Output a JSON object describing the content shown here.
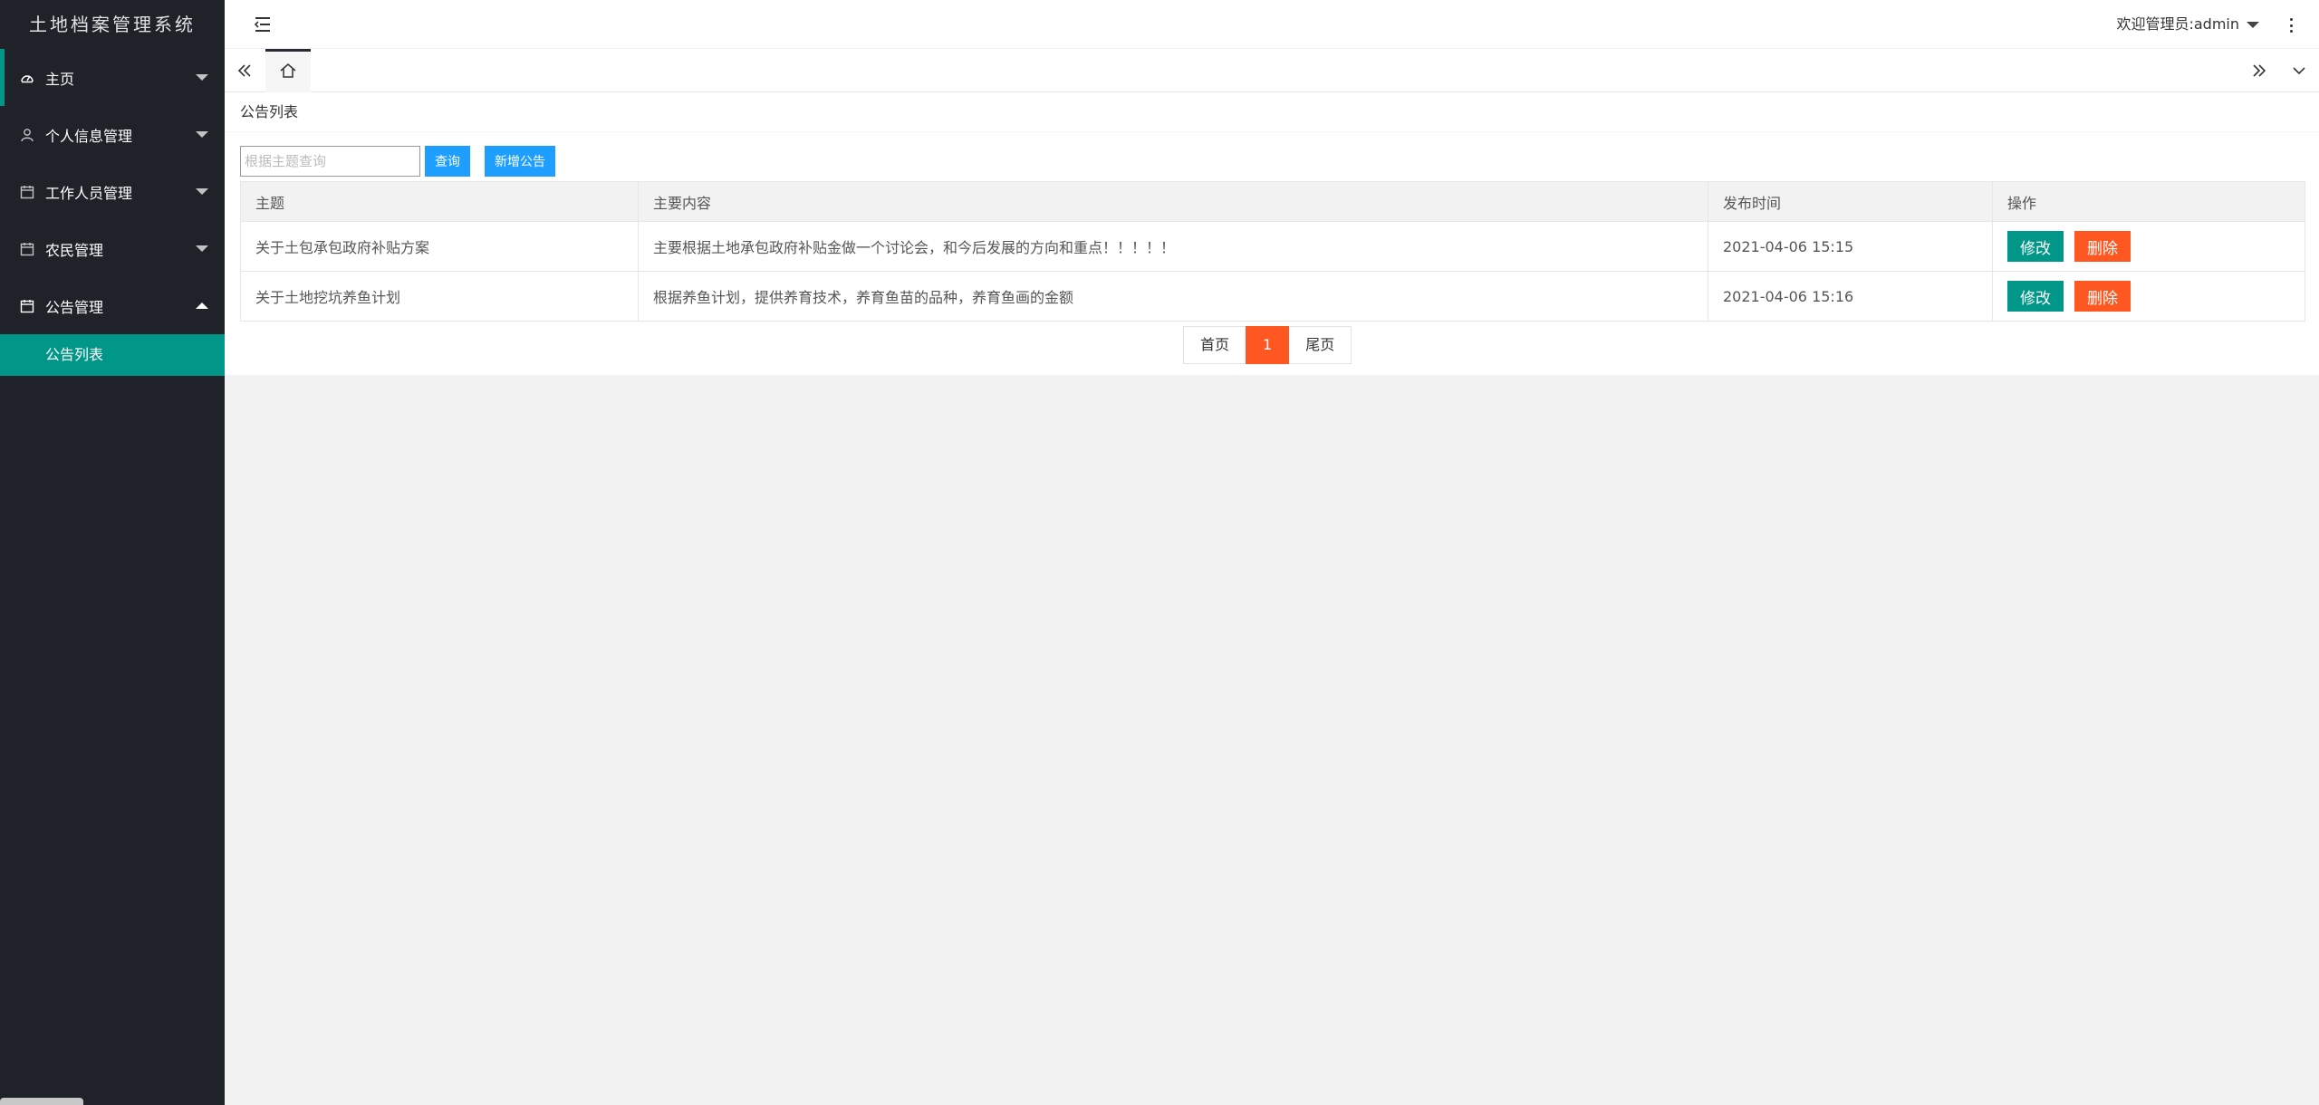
{
  "app": {
    "title": "土地档案管理系统"
  },
  "sidebar": {
    "items": [
      {
        "label": "主页",
        "icon": "dashboard-icon",
        "expanded": false
      },
      {
        "label": "个人信息管理",
        "icon": "user-icon",
        "expanded": false
      },
      {
        "label": "工作人员管理",
        "icon": "calendar-icon",
        "expanded": false
      },
      {
        "label": "农民管理",
        "icon": "calendar-icon",
        "expanded": false
      },
      {
        "label": "公告管理",
        "icon": "calendar-icon",
        "expanded": true
      }
    ],
    "subitems": [
      {
        "label": "公告列表",
        "active": true
      }
    ]
  },
  "header": {
    "user_label": "欢迎管理员:admin"
  },
  "page": {
    "title": "公告列表",
    "search": {
      "placeholder": "根据主题查询",
      "value": ""
    },
    "query_button": "查询",
    "add_button": "新增公告",
    "table": {
      "headers": [
        "主题",
        "主要内容",
        "发布时间",
        "操作"
      ],
      "rows": [
        {
          "subject": "关于土包承包政府补贴方案",
          "content": "主要根据土地承包政府补贴金做一个讨论会，和今后发展的方向和重点！！！！！",
          "time": "2021-04-06 15:15"
        },
        {
          "subject": "关于土地挖坑养鱼计划",
          "content": "根据养鱼计划，提供养育技术，养育鱼苗的品种，养育鱼画的金额",
          "time": "2021-04-06 15:16"
        }
      ],
      "edit_label": "修改",
      "delete_label": "删除"
    },
    "pager": {
      "first": "首页",
      "current": "1",
      "last": "尾页"
    }
  },
  "colors": {
    "sidebar_bg": "#20222a",
    "accent": "#009688",
    "primary": "#1e9fff",
    "danger": "#ff5722"
  }
}
